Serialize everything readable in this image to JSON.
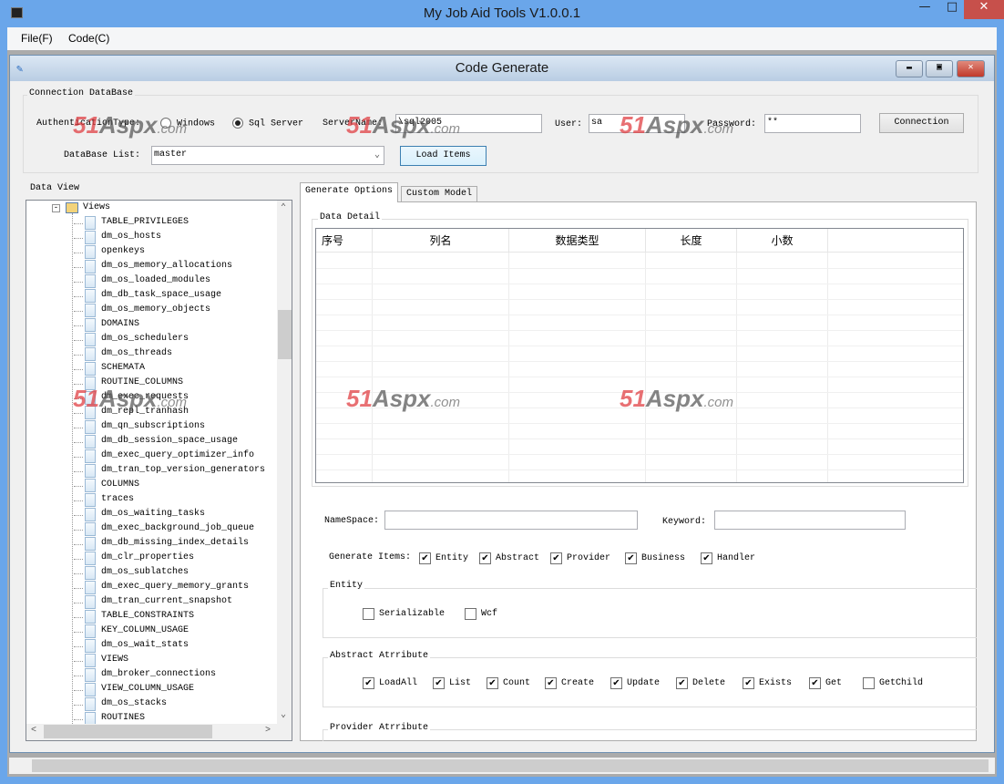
{
  "app": {
    "title": "My Job Aid Tools V1.0.0.1",
    "menu": [
      "File(F)",
      "Code(C)"
    ]
  },
  "child": {
    "title": "Code Generate"
  },
  "connection": {
    "group_label": "Connection DataBase",
    "auth_label": "AuthenticationType:",
    "auth_options": [
      {
        "label": "Windows",
        "selected": false
      },
      {
        "label": "Sql Server",
        "selected": true
      }
    ],
    "server_label": "ServerName:",
    "server_value": "\\sql2005",
    "user_label": "User:",
    "user_value": "sa",
    "password_label": "Password:",
    "password_value": "**",
    "connect_button": "Connection",
    "db_list_label": "DataBase List:",
    "db_list_value": "master",
    "load_button": "Load Items"
  },
  "data_view": {
    "label": "Data View",
    "root": "Views",
    "items": [
      "TABLE_PRIVILEGES",
      "dm_os_hosts",
      "openkeys",
      "dm_os_memory_allocations",
      "dm_os_loaded_modules",
      "dm_db_task_space_usage",
      "dm_os_memory_objects",
      "DOMAINS",
      "dm_os_schedulers",
      "dm_os_threads",
      "SCHEMATA",
      "ROUTINE_COLUMNS",
      "dm_exec_requests",
      "dm_repl_tranhash",
      "dm_qn_subscriptions",
      "dm_db_session_space_usage",
      "dm_exec_query_optimizer_info",
      "dm_tran_top_version_generators",
      "COLUMNS",
      "traces",
      "dm_os_waiting_tasks",
      "dm_exec_background_job_queue",
      "dm_db_missing_index_details",
      "dm_clr_properties",
      "dm_os_sublatches",
      "dm_exec_query_memory_grants",
      "dm_tran_current_snapshot",
      "TABLE_CONSTRAINTS",
      "KEY_COLUMN_USAGE",
      "dm_os_wait_stats",
      "VIEWS",
      "dm_broker_connections",
      "VIEW_COLUMN_USAGE",
      "dm_os_stacks",
      "ROUTINES"
    ]
  },
  "tabs": [
    {
      "label": "Generate Options",
      "active": true
    },
    {
      "label": "Custom Model",
      "active": false
    }
  ],
  "data_detail": {
    "label": "Data Detail",
    "columns": [
      "序号",
      "列名",
      "数据类型",
      "长度",
      "小数"
    ]
  },
  "options": {
    "namespace_label": "NameSpace:",
    "namespace_value": "",
    "keyword_label": "Keyword:",
    "keyword_value": "",
    "generate_items_label": "Generate Items:",
    "generate_items": [
      {
        "label": "Entity",
        "checked": true
      },
      {
        "label": "Abstract",
        "checked": true
      },
      {
        "label": "Provider",
        "checked": true
      },
      {
        "label": "Business",
        "checked": true
      },
      {
        "label": "Handler",
        "checked": true
      }
    ],
    "entity_label": "Entity",
    "entity_items": [
      {
        "label": "Serializable",
        "checked": false
      },
      {
        "label": "Wcf",
        "checked": false
      }
    ],
    "abstract_label": "Abstract Atrribute",
    "abstract_items": [
      {
        "label": "LoadAll",
        "checked": true
      },
      {
        "label": "List",
        "checked": true
      },
      {
        "label": "Count",
        "checked": true
      },
      {
        "label": "Create",
        "checked": true
      },
      {
        "label": "Update",
        "checked": true
      },
      {
        "label": "Delete",
        "checked": true
      },
      {
        "label": "Exists",
        "checked": true
      },
      {
        "label": "Get",
        "checked": true
      },
      {
        "label": "GetChild",
        "checked": false
      }
    ],
    "provider_label": "Provider Atrribute"
  },
  "watermark": {
    "text_a": "51",
    "text_b": "Aspx",
    "text_c": ".com"
  }
}
